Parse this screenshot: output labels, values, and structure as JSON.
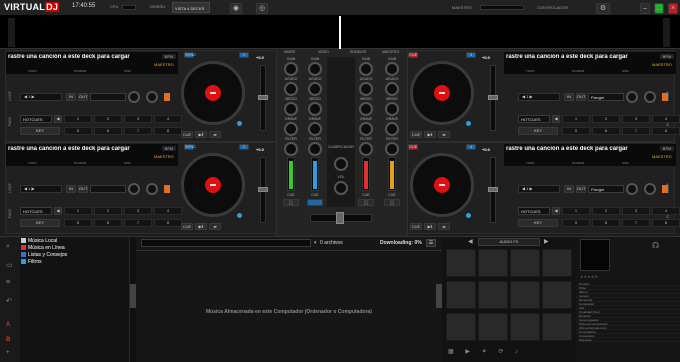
{
  "app": {
    "logo_virtual": "VIRTUAL",
    "logo_dj": "DJ",
    "clock": "17:40:55",
    "cpu_label": "CPU",
    "layout_label": "DISEÑO",
    "layout_value": "VISTA 4 DECKS",
    "master_label": "MAESTRO",
    "controller_label": "CONTROLADOR"
  },
  "decks": [
    {
      "title": "rastre una canción a este deck para cargar",
      "bpm_label": "BPM",
      "master_label": "MAESTRO",
      "ticks": [
        "TONO",
        "PAURAR",
        "SINC"
      ],
      "key": "+0.0",
      "fx_name": "Flanger",
      "hotcues": "HOTCUES",
      "cue": "CUE",
      "pads": [
        "1",
        "2",
        "3",
        "4",
        "5",
        "6",
        "7",
        "8"
      ],
      "number": "3"
    },
    {
      "title": "rastre una canción a este deck para cargar",
      "bpm_label": "BPM",
      "master_label": "MAESTRO",
      "ticks": [
        "TONO",
        "PAURAR",
        "SINC"
      ],
      "key": "+0.0",
      "fx_name": "Flanger",
      "hotcues": "HOTCUES",
      "cue": "CUE",
      "pads": [
        "1",
        "2",
        "3",
        "4",
        "5",
        "6",
        "7",
        "8"
      ],
      "number": "4"
    },
    {
      "title": "rastre una canción a este deck para cargar",
      "bpm_label": "BPM",
      "master_label": "MAESTRO",
      "ticks": [
        "TONO",
        "PAURAR",
        "SINC"
      ],
      "key": "+0.0",
      "fx_name": "",
      "hotcues": "HOTCUES",
      "cue": "CUE",
      "pads": [
        "1",
        "2",
        "3",
        "4",
        "5",
        "6",
        "7",
        "8"
      ],
      "number": "1"
    },
    {
      "title": "rastre una canción a este deck para cargar",
      "bpm_label": "BPM",
      "master_label": "MAESTRO",
      "ticks": [
        "TONO",
        "PAURAR",
        "SINC"
      ],
      "key": "+0.0",
      "fx_name": "",
      "hotcues": "HOTCUES",
      "cue": "CUE",
      "pads": [
        "1",
        "2",
        "3",
        "4",
        "5",
        "6",
        "7",
        "8"
      ],
      "number": "2"
    }
  ],
  "mixer": {
    "tabs": [
      "MIXER",
      "VIDEO",
      "SONIDOS",
      "MAESTRO"
    ],
    "channel_labels": [
      "GAIN",
      "AGUDO",
      "MEDIO",
      "GRAVE",
      "FILTER"
    ],
    "sync_label": "SINC",
    "vol_label": "VOL",
    "headphone_label": "CUE",
    "crossfader_label": "CLASIFICADOR",
    "master_label": "MASTER",
    "level_colors": [
      "#33cc33",
      "#2aa0e0",
      "#e03030",
      "#e0a020"
    ]
  },
  "browser": {
    "tree": [
      {
        "label": "Música Local",
        "color": "#cccccc"
      },
      {
        "label": "Música en Línea",
        "color": "#e03030"
      },
      {
        "label": "Listas y Consejos",
        "color": "#3a70d0"
      },
      {
        "label": "Filtros",
        "color": "#2aa0e0"
      }
    ],
    "files_count": "0 archivos",
    "downloading": "Downloading: 0%",
    "empty_message": "Música Almacenada en este Computador (Ordenador o Computadora)",
    "fx_tab": "AUDIO FX",
    "info_fields": [
      "Nombre",
      "Pista",
      "Álbum",
      "Género",
      "Remezcla",
      "Compositor",
      "Año",
      "Tonalidad (Key)",
      "Duración",
      "Veces jugadas",
      "Primera reproducción",
      "Última Reproducción",
      "Comentarios",
      "Comentario",
      "Etiquetas"
    ]
  }
}
